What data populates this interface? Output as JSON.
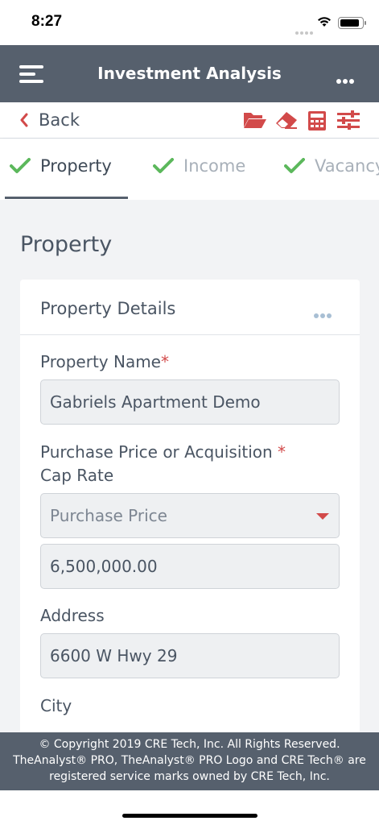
{
  "status_bar": {
    "time": "8:27"
  },
  "header": {
    "title": "Investment Analysis"
  },
  "toolbar": {
    "back_label": "Back",
    "icons": [
      "folder-open-icon",
      "eraser-icon",
      "calculator-icon",
      "sliders-icon"
    ],
    "accent_color": "#d24a4a"
  },
  "tabs": [
    {
      "label": "Property",
      "active": true
    },
    {
      "label": "Income",
      "active": false
    },
    {
      "label": "Vacancy",
      "active": false
    }
  ],
  "page": {
    "title": "Property"
  },
  "card": {
    "title": "Property Details",
    "fields": {
      "property_name": {
        "label": "Property Name",
        "required_mark": "*",
        "value": "Gabriels Apartment Demo"
      },
      "purchase": {
        "label_line1": "Purchase Price or Acquisition",
        "label_line2": "Cap Rate",
        "required_mark": "*",
        "select_value": "Purchase Price",
        "amount_value": "6,500,000.00"
      },
      "address": {
        "label": "Address",
        "value": "6600 W Hwy 29"
      },
      "city": {
        "label": "City"
      }
    }
  },
  "footer": {
    "copyright": "© Copyright 2019 CRE Tech, Inc. All Rights Reserved. TheAnalyst® PRO, TheAnalyst® PRO Logo and CRE Tech® are registered service marks owned by CRE Tech, Inc."
  },
  "colors": {
    "header_bg": "#56606d",
    "check_green": "#5cb85c",
    "accent_red": "#d24a4a",
    "content_bg": "#f2f3f5"
  }
}
